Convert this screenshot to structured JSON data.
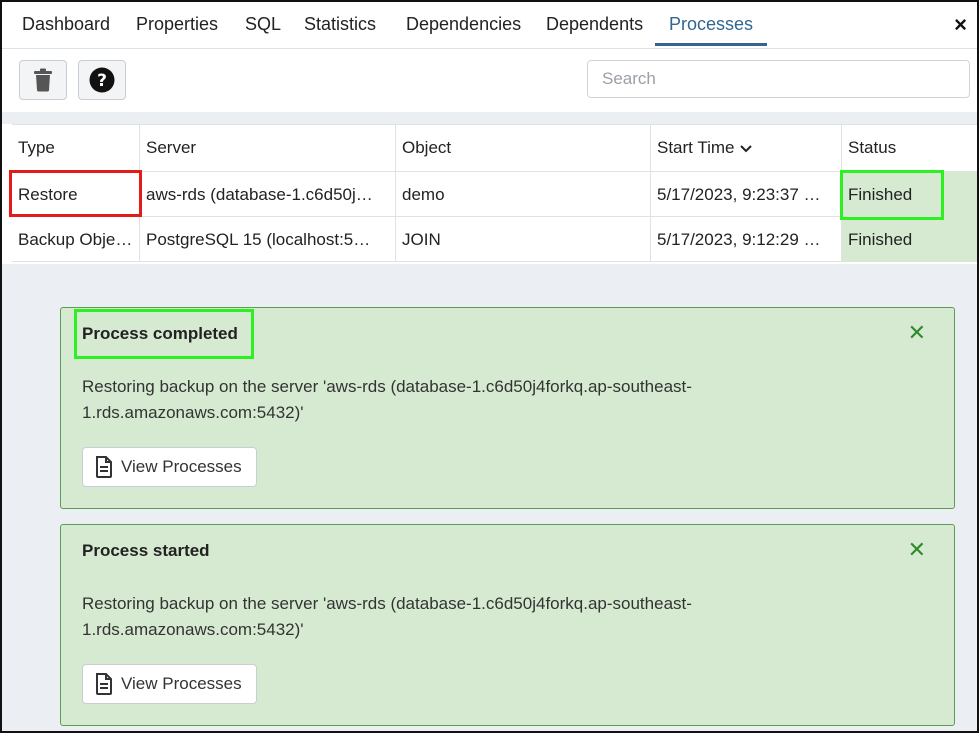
{
  "tabs": [
    {
      "label": "Dashboard"
    },
    {
      "label": "Properties"
    },
    {
      "label": "SQL"
    },
    {
      "label": "Statistics"
    },
    {
      "label": "Dependencies"
    },
    {
      "label": "Dependents"
    },
    {
      "label": "Processes"
    }
  ],
  "active_tab": "Processes",
  "close_glyph": "×",
  "toolbar": {
    "delete_icon": "trash-icon",
    "help_icon": "help-circle-icon",
    "search_placeholder": "Search"
  },
  "table": {
    "columns": [
      "Type",
      "Server",
      "Object",
      "Start Time",
      "Status"
    ],
    "sort_icon": "chevron-down-icon",
    "rows": [
      {
        "type": "Restore",
        "server": "aws-rds (database-1.c6d50j…",
        "object": "demo",
        "start_time": "5/17/2023, 9:23:37 …",
        "status": "Finished"
      },
      {
        "type": "Backup Obje…",
        "server": "PostgreSQL 15 (localhost:5…",
        "object": "JOIN",
        "start_time": "5/17/2023, 9:12:29 …",
        "status": "Finished"
      }
    ]
  },
  "notifications": [
    {
      "title": "Process completed",
      "message": "Restoring backup on the server 'aws-rds (database-1.c6d50j4forkq.ap-southeast-1.rds.amazonaws.com:5432)'",
      "button_label": "View Processes",
      "close_glyph": "✕"
    },
    {
      "title": "Process started",
      "message": "Restoring backup on the server 'aws-rds (database-1.c6d50j4forkq.ap-southeast-1.rds.amazonaws.com:5432)'",
      "button_label": "View Processes",
      "close_glyph": "✕"
    }
  ],
  "colors": {
    "accent": "#326690",
    "success_bg": "#d6ead1",
    "success_border": "#5a9e54",
    "highlight_red": "#e31b1b",
    "highlight_green": "#2cf021"
  }
}
